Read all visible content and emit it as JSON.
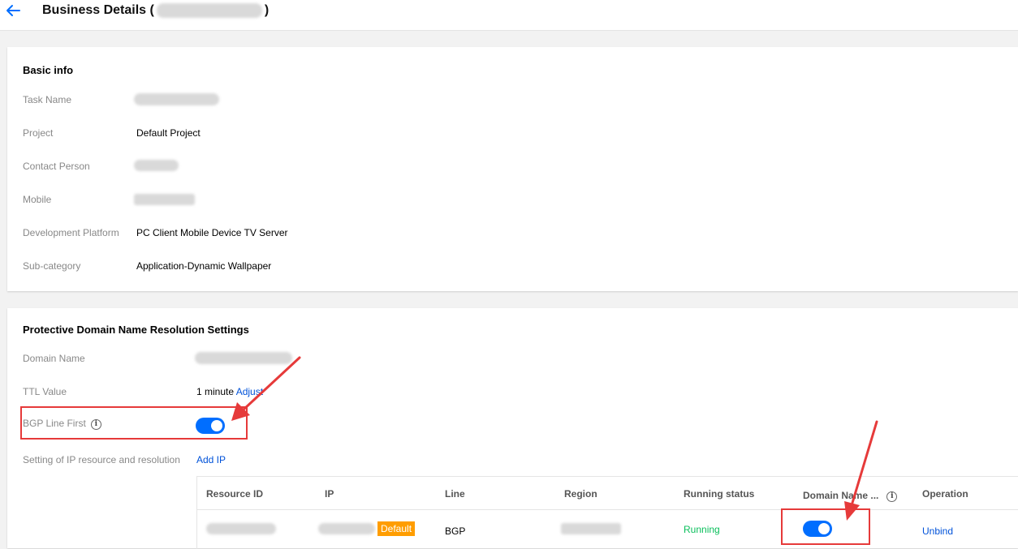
{
  "header": {
    "title_prefix": "Business Details (",
    "title_suffix": ")"
  },
  "basic_info": {
    "title": "Basic info",
    "rows": [
      {
        "label": "Task Name",
        "value": ""
      },
      {
        "label": "Project",
        "value": "Default Project"
      },
      {
        "label": "Contact Person",
        "value": ""
      },
      {
        "label": "Mobile",
        "value": ""
      },
      {
        "label": "Development Platform",
        "value": "PC Client Mobile Device TV Server"
      },
      {
        "label": "Sub-category",
        "value": "Application-Dynamic Wallpaper"
      }
    ]
  },
  "protect": {
    "title": "Protective Domain Name Resolution Settings",
    "domain_label": "Domain Name",
    "ttl_label": "TTL Value",
    "ttl_value": "1 minute",
    "ttl_adjust": "Adjust",
    "bgp_label": "BGP Line First",
    "bgp_enabled": true,
    "ip_setting_label": "Setting of IP resource and resolution",
    "add_ip": "Add IP"
  },
  "table": {
    "columns": [
      "Resource ID",
      "IP",
      "Line",
      "Region",
      "Running status",
      "Domain Name ...",
      "Operation"
    ],
    "rows": [
      {
        "ip_badge": "Default",
        "line": "BGP",
        "status": "Running",
        "domain_enabled": true,
        "operation": "Unbind"
      }
    ]
  },
  "icons": {
    "back": "arrow-left-icon",
    "info": "info-circle-icon"
  },
  "colors": {
    "accent": "#006eff",
    "link": "#0052d9",
    "running": "#0abf5b",
    "badge": "#ff9d00",
    "annotation": "#e63a3a"
  }
}
